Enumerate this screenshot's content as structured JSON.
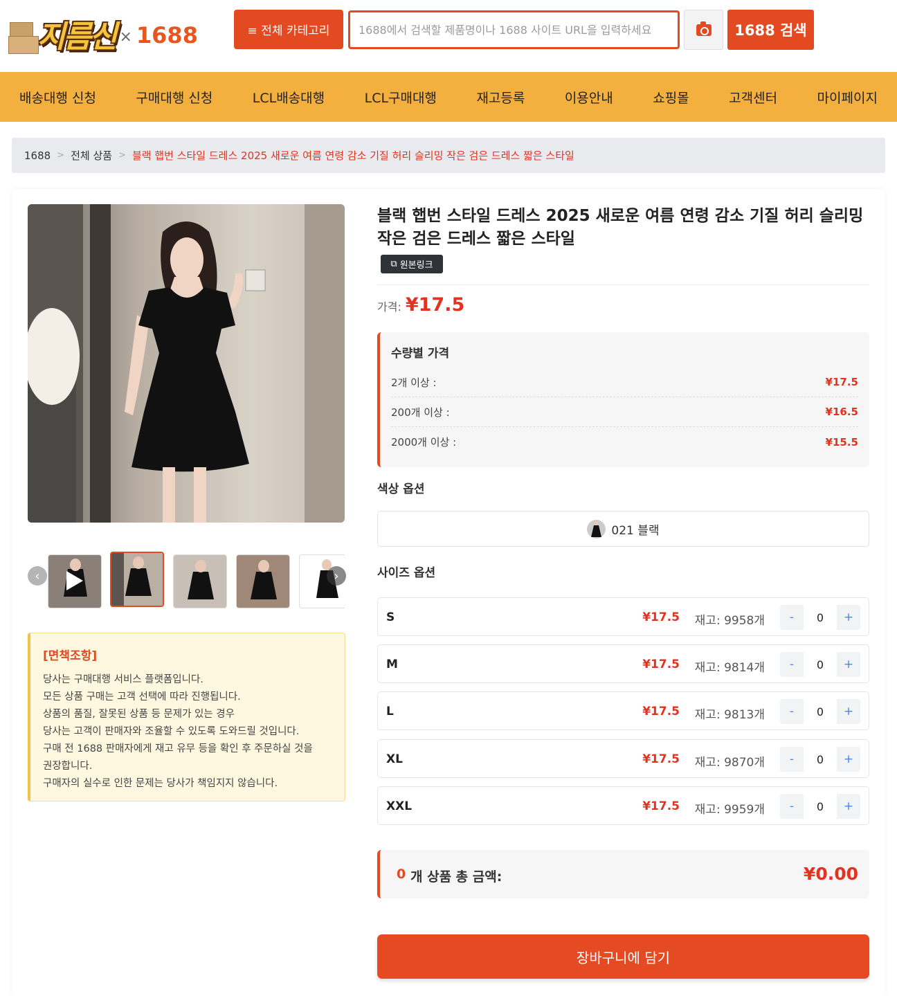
{
  "header": {
    "logo_text": "지름신",
    "logo_x": "×",
    "logo_1688": "1688",
    "category_button": "≡ 전체 카테고리",
    "search_placeholder": "1688에서 검색할 제품명이나 1688 사이트 URL을 입력하세요",
    "search_button": "1688 검색"
  },
  "nav": {
    "items": [
      "배송대행 신청",
      "구매대행 신청",
      "LCL배송대행",
      "LCL구매대행",
      "재고등록",
      "이용안내",
      "쇼핑몰",
      "고객센터",
      "마이페이지"
    ]
  },
  "breadcrumb": {
    "items": [
      "1688",
      "전체 상품"
    ],
    "current": "블랙 햅번 스타일 드레스 2025 새로운 여름 연령 감소 기질 허리 슬리밍 작은 검은 드레스 짧은 스타일",
    "separator": ">"
  },
  "product": {
    "title": "블랙 햅번 스타일 드레스 2025 새로운 여름 연령 감소 기질 허리 슬리밍 작은 검은 드레스 짧은 스타일",
    "original_link": "원본링크",
    "price_label": "가격:",
    "price": "¥17.5",
    "tier_title": "수량별 가격",
    "tiers": [
      {
        "label": "2개 이상 :",
        "price": "¥17.5"
      },
      {
        "label": "200개 이상 :",
        "price": "¥16.5"
      },
      {
        "label": "2000개 이상 :",
        "price": "¥15.5"
      }
    ],
    "color_label": "색상 옵션",
    "color_option": "021 블랙",
    "size_label": "사이즈 옵션",
    "sizes": [
      {
        "name": "S",
        "price": "¥17.5",
        "stock": "재고: 9958개",
        "qty": "0"
      },
      {
        "name": "M",
        "price": "¥17.5",
        "stock": "재고: 9814개",
        "qty": "0"
      },
      {
        "name": "L",
        "price": "¥17.5",
        "stock": "재고: 9813개",
        "qty": "0"
      },
      {
        "name": "XL",
        "price": "¥17.5",
        "stock": "재고: 9870개",
        "qty": "0"
      },
      {
        "name": "XXL",
        "price": "¥17.5",
        "stock": "재고: 9959개",
        "qty": "0"
      }
    ],
    "minus": "-",
    "plus": "+",
    "total_count": "0",
    "total_label": "개 상품 총 금액:",
    "total_amount": "¥0.00",
    "cart_button": "장바구니에 담기"
  },
  "notice": {
    "title": "[면책조항]",
    "lines": [
      "당사는 구매대행 서비스 플랫폼입니다.",
      "모든 상품 구매는 고객 선택에 따라 진행됩니다.",
      "상품의 품질, 잘못된 상품 등 문제가 있는 경우",
      "당사는 고객이 판매자와 조율할 수 있도록 도와드릴 것입니다.",
      "구매 전 1688 판매자에게 재고 유무 등을 확인 후 주문하실 것을",
      "권장합니다.",
      "구매자의 실수로 인한 문제는 당사가 책임지지 않습니다."
    ]
  },
  "colors": {
    "accent": "#e34a21",
    "nav_bg": "#f3b03e",
    "price": "#e3321f"
  },
  "icons": {
    "camera": "camera-icon",
    "external": "external-link-icon",
    "prev": "chevron-left-icon",
    "next": "chevron-right-icon",
    "play": "play-icon"
  }
}
